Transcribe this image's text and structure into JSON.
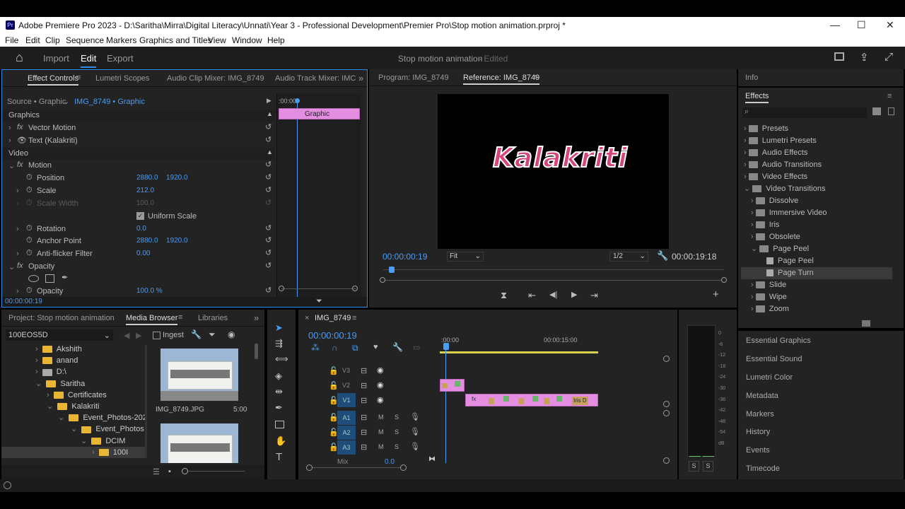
{
  "window": {
    "title": "Adobe Premiere Pro 2023 - D:\\Saritha\\Mirra\\Digital Literacy\\Unnati\\Year 3 - Professional Development\\Premier Pro\\Stop motion animation.prproj *",
    "icon": "Pr",
    "minimize": "—",
    "maximize": "☐",
    "close": "✕"
  },
  "menu": [
    "File",
    "Edit",
    "Clip",
    "Sequence",
    "Markers",
    "Graphics and Titles",
    "View",
    "Window",
    "Help"
  ],
  "appbar": {
    "home": "⌂",
    "workspaces": [
      "Import",
      "Edit",
      "Export"
    ],
    "project": "Stop motion animation",
    "status": "- Edited"
  },
  "effect_controls": {
    "tabs": [
      "Effect Controls",
      "Lumetri Scopes",
      "Audio Clip Mixer: IMG_8749",
      "Audio Track Mixer: IMC"
    ],
    "source": "Source • Graphic",
    "clip": "IMG_8749 • Graphic",
    "timeline_start": ":00:00",
    "graphic_clip": "Graphic",
    "sec_graphics": "Graphics",
    "vector_motion": "Vector Motion",
    "text_layer": "Text (Kalakriti)",
    "sec_video": "Video",
    "motion": "Motion",
    "position": {
      "label": "Position",
      "x": "2880.0",
      "y": "1920.0"
    },
    "scale": {
      "label": "Scale",
      "value": "212.0"
    },
    "scale_width": {
      "label": "Scale Width",
      "value": "100.0"
    },
    "uniform": "Uniform Scale",
    "rotation": {
      "label": "Rotation",
      "value": "0.0"
    },
    "anchor": {
      "label": "Anchor Point",
      "x": "2880.0",
      "y": "1920.0"
    },
    "antiflicker": {
      "label": "Anti-flicker Filter",
      "value": "0.00"
    },
    "opacity": "Opacity",
    "opacity_prop": {
      "label": "Opacity",
      "value": "100.0 %"
    },
    "timecode": "00:00:00:19"
  },
  "monitor": {
    "tabs": [
      "Program: IMG_8749",
      "Reference: IMG_8749"
    ],
    "text": "Kalakriti",
    "timecode": "00:00:00:19",
    "fit": "Fit",
    "resolution": "1/2",
    "duration": "00:00:19:18"
  },
  "effects": {
    "info": "Info",
    "title": "Effects",
    "items": [
      "Presets",
      "Lumetri Presets",
      "Audio Effects",
      "Audio Transitions",
      "Video Effects",
      "Video Transitions"
    ],
    "subfolders": [
      "Dissolve",
      "Immersive Video",
      "Iris",
      "Obsolete",
      "Page Peel"
    ],
    "page_peel": [
      "Page Peel",
      "Page Turn"
    ],
    "more": [
      "Slide",
      "Wipe",
      "Zoom"
    ],
    "panels": [
      "Essential Graphics",
      "Essential Sound",
      "Lumetri Color",
      "Metadata",
      "Markers",
      "History",
      "Events",
      "Timecode"
    ]
  },
  "project": {
    "tabs": [
      "Project: Stop motion animation",
      "Media Browser",
      "Libraries"
    ],
    "drive": "100EOS5D",
    "ingest": "Ingest",
    "tree": [
      "Akshith",
      "anand",
      "D:\\",
      "Saritha",
      "Certificates",
      "Kalakriti",
      "Event_Photos-202",
      "Event_Photos",
      "DCIM",
      "100I"
    ],
    "thumb_name": "IMG_8749.JPG",
    "thumb_dur": "5:00"
  },
  "timeline": {
    "tab": "IMG_8749",
    "timecode": "00:00:00:19",
    "ruler": [
      ":00:00",
      "00:00:15:00"
    ],
    "tracks_v": [
      "V3",
      "V2",
      "V1"
    ],
    "tracks_a": [
      "A1",
      "A2",
      "A3"
    ],
    "mix": "Mix",
    "mix_val": "0.0",
    "clips": [
      "Iris D"
    ]
  },
  "meter": {
    "scale": [
      "0",
      "-6",
      "-12",
      "-18",
      "-24",
      "-30",
      "-36",
      "-42",
      "-48",
      "-54",
      "dB"
    ],
    "solo": [
      "S",
      "S"
    ]
  }
}
